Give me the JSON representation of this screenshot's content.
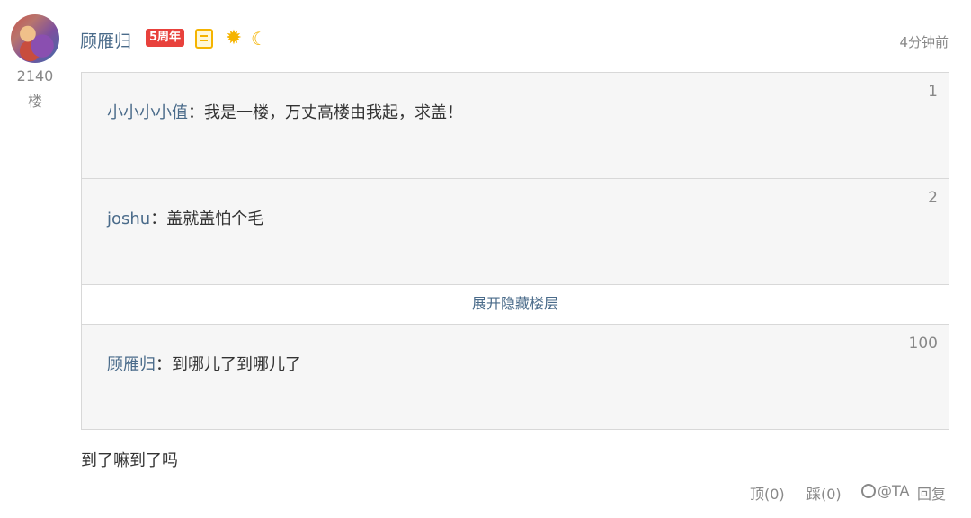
{
  "post": {
    "floor_number": "2140",
    "floor_label": "楼",
    "username": "顾雁归",
    "badges": {
      "anniversary_label": "5周年",
      "icons": [
        "doc-badge-icon",
        "sun-icon",
        "moon-icon"
      ]
    },
    "time": "4分钟前",
    "quotes": [
      {
        "name": "小小小小值",
        "sep": "：",
        "text": "我是一楼，万丈高楼由我起，求盖！",
        "floor": "1"
      },
      {
        "name": "joshu",
        "sep": "：",
        "text": "盖就盖怕个毛",
        "floor": "2"
      },
      {
        "name": "顾雁归",
        "sep": "：",
        "text": "到哪儿了到哪儿了",
        "floor": "100"
      }
    ],
    "expand_label": "展开隐藏楼层",
    "reply_text": "到了嘛到了吗",
    "actions": {
      "up": "顶(0)",
      "down": "踩(0)",
      "ta": "@TA",
      "reply": "回复"
    }
  },
  "colors": {
    "link": "#4a6b8a",
    "muted": "#888888",
    "quote_bg": "#f6f6f6",
    "badge_red": "#e8413c",
    "badge_gold": "#f5b400"
  }
}
